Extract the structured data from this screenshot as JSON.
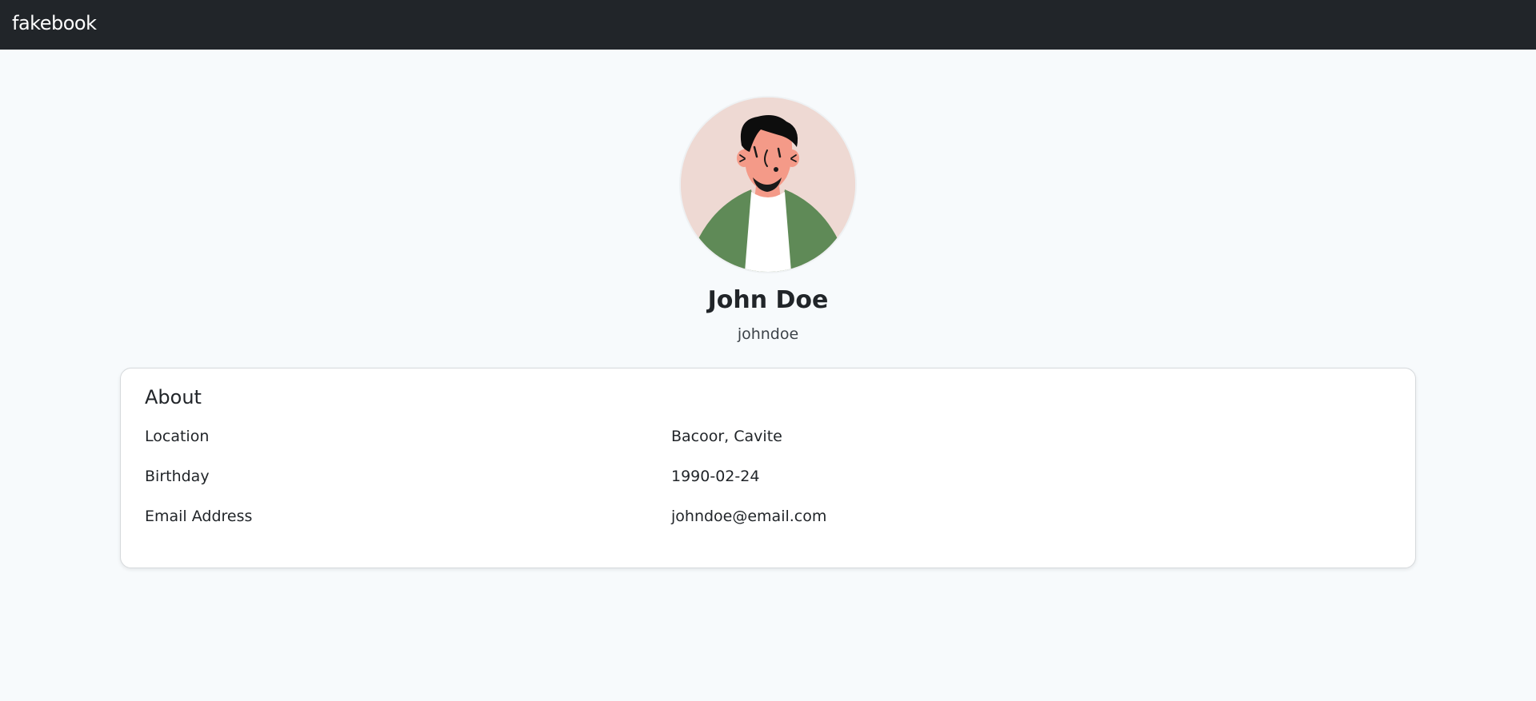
{
  "navbar": {
    "brand": "fakebook"
  },
  "profile": {
    "name": "John Doe",
    "username": "johndoe"
  },
  "about": {
    "title": "About",
    "rows": [
      {
        "label": "Location",
        "value": "Bacoor, Cavite"
      },
      {
        "label": "Birthday",
        "value": "1990-02-24"
      },
      {
        "label": "Email Address",
        "value": "johndoe@email.com"
      }
    ]
  },
  "colors": {
    "navbar_bg": "#212529",
    "page_bg": "#f7fafc",
    "avatar_bg": "#eed9d3",
    "jacket": "#5f8a57",
    "skin": "#f49a88"
  }
}
